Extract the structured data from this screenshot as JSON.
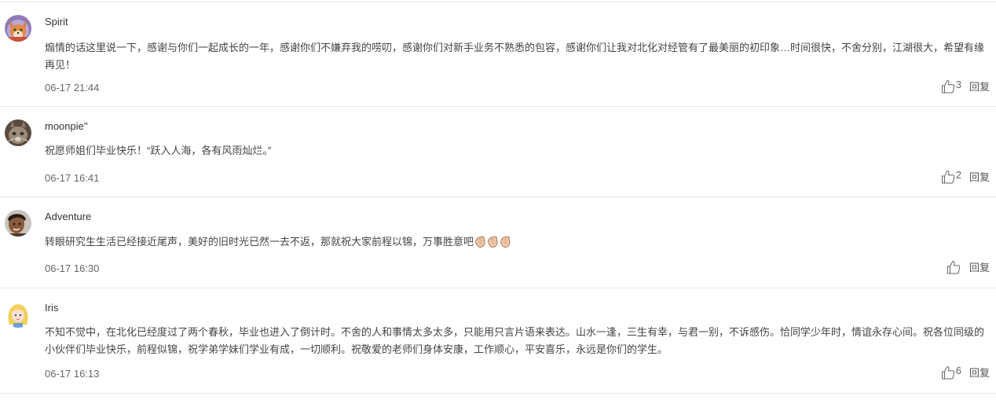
{
  "comments": [
    {
      "username": "Spirit",
      "avatar_icon": "fox-character-avatar",
      "content": "煽情的话这里说一下，感谢与你们一起成长的一年，感谢你们不嫌弃我的唠叨，感谢你们对新手业务不熟悉的包容，感谢你们让我对北化对经管有了最美丽的初印象…时间很快，不舍分别，江湖很大，希望有缘再见！",
      "time": "06-17 21:44",
      "likes": "3",
      "reply_label": "回复"
    },
    {
      "username": "moonpie''",
      "avatar_icon": "cat-photo-avatar",
      "content": "祝愿师姐们毕业快乐！“跃入人海，各有风雨灿烂。”",
      "time": "06-17 16:41",
      "likes": "2",
      "reply_label": "回复"
    },
    {
      "username": "Adventure",
      "avatar_icon": "person-photo-avatar",
      "content": "转眼研究生生活已经接近尾声，美好的旧时光已然一去不返，那就祝大家前程以锦，万事胜意吧",
      "emoji_icons": [
        "clapping-hands-emoji",
        "clapping-hands-emoji",
        "clapping-hands-emoji"
      ],
      "time": "06-17 16:30",
      "likes": "",
      "reply_label": "回复"
    },
    {
      "username": "Iris",
      "avatar_icon": "princess-cartoon-avatar",
      "content": "不知不觉中，在北化已经度过了两个春秋，毕业也进入了倒计时。不舍的人和事情太多太多，只能用只言片语来表达。山水一逢，三生有幸，与君一别，不诉感伤。恰同学少年时，情谊永存心间。祝各位同级的小伙伴们毕业快乐，前程似锦，祝学弟学妹们学业有成，一切顺利。祝敬爱的老师们身体安康，工作顺心，平安喜乐，永远是你们的学生。",
      "time": "06-17 16:13",
      "likes": "6",
      "reply_label": "回复"
    }
  ],
  "colors": {
    "divider": "#e8e8e8",
    "text": "#333333",
    "meta": "#666666"
  }
}
